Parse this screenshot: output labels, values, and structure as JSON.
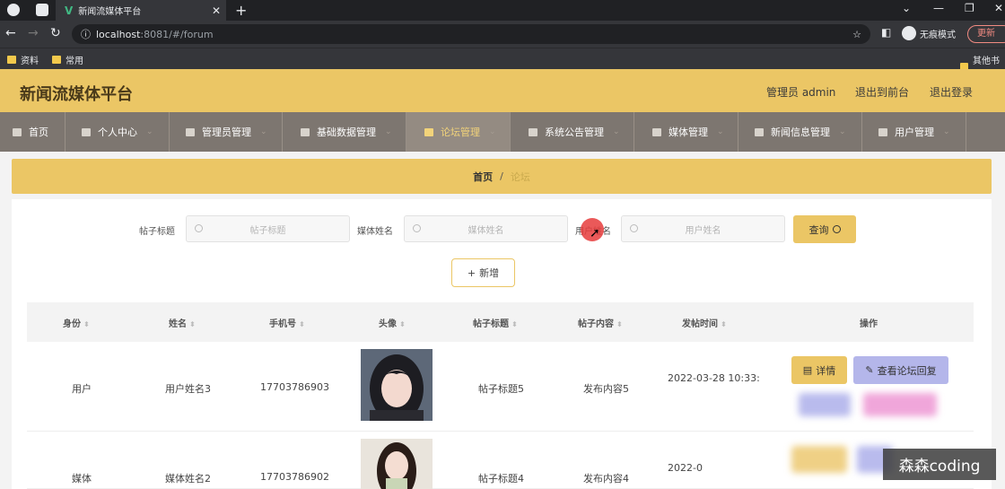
{
  "browser": {
    "tab_title": "新闻流媒体平台",
    "url_host": "localhost",
    "url_rest": ":8081/#/forum",
    "incognito_label": "无痕模式",
    "update_label": "更新",
    "bookmarks": [
      "资料",
      "常用"
    ],
    "bookmarks_right": "其他书签"
  },
  "site": {
    "title": "新闻流媒体平台",
    "user_label": "管理员 admin",
    "back_to_front": "退出到前台",
    "logout": "退出登录"
  },
  "menu": [
    {
      "label": "首页"
    },
    {
      "label": "个人中心"
    },
    {
      "label": "管理员管理"
    },
    {
      "label": "基础数据管理"
    },
    {
      "label": "论坛管理"
    },
    {
      "label": "系统公告管理"
    },
    {
      "label": "媒体管理"
    },
    {
      "label": "新闻信息管理"
    },
    {
      "label": "用户管理"
    }
  ],
  "breadcrumb": {
    "home": "首页",
    "separator": "/",
    "current": "论坛"
  },
  "filters": {
    "post_title_label": "帖子标题",
    "post_title_placeholder": "帖子标题",
    "media_name_label": "媒体姓名",
    "media_name_placeholder": "媒体姓名",
    "user_name_label": "用户姓名",
    "user_name_placeholder": "用户姓名",
    "query_label": "查询",
    "add_label": "新增"
  },
  "table": {
    "columns": [
      "身份",
      "姓名",
      "手机号",
      "头像",
      "帖子标题",
      "帖子内容",
      "发帖时间",
      "操作"
    ],
    "rows": [
      {
        "role": "用户",
        "name": "用户姓名3",
        "phone": "17703786903",
        "title": "帖子标题5",
        "content": "发布内容5",
        "time": "2022-03-28 10:33:"
      },
      {
        "role": "媒体",
        "name": "媒体姓名2",
        "phone": "17703786902",
        "title": "帖子标题4",
        "content": "发布内容4",
        "time": "2022-0"
      }
    ],
    "detail_label": "详情",
    "reply_label": "查看论坛回复"
  },
  "watermark": "森森coding",
  "colors": {
    "accent": "#ebc665",
    "menu_bg": "#7d7670",
    "reply_btn": "#b4b6ea"
  }
}
